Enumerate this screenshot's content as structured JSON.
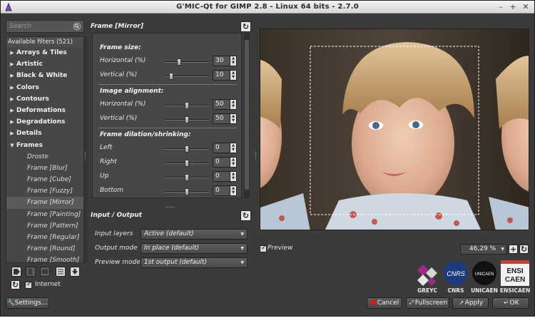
{
  "window": {
    "title": "G'MIC-Qt for GIMP 2.8 - Linux 64 bits - 2.7.0"
  },
  "search": {
    "placeholder": "Search"
  },
  "filters": {
    "header": "Available filters (521)",
    "items": [
      {
        "label": "Arrays & Tiles",
        "kind": "cat",
        "arrow": "▶"
      },
      {
        "label": "Artistic",
        "kind": "cat",
        "arrow": "▶"
      },
      {
        "label": "Black & White",
        "kind": "cat",
        "arrow": "▶"
      },
      {
        "label": "Colors",
        "kind": "cat",
        "arrow": "▶"
      },
      {
        "label": "Contours",
        "kind": "cat",
        "arrow": "▶"
      },
      {
        "label": "Deformations",
        "kind": "cat",
        "arrow": "▶"
      },
      {
        "label": "Degradations",
        "kind": "cat",
        "arrow": "▶"
      },
      {
        "label": "Details",
        "kind": "cat",
        "arrow": "▶"
      },
      {
        "label": "Frames",
        "kind": "cat",
        "arrow": "▼"
      },
      {
        "label": "Droste",
        "kind": "sub"
      },
      {
        "label": "Frame [Blur]",
        "kind": "sub"
      },
      {
        "label": "Frame [Cube]",
        "kind": "sub"
      },
      {
        "label": "Frame [Fuzzy]",
        "kind": "sub"
      },
      {
        "label": "Frame [Mirror]",
        "kind": "sub",
        "selected": true
      },
      {
        "label": "Frame [Painting]",
        "kind": "sub"
      },
      {
        "label": "Frame [Pattern]",
        "kind": "sub"
      },
      {
        "label": "Frame [Regular]",
        "kind": "sub"
      },
      {
        "label": "Frame [Round]",
        "kind": "sub"
      },
      {
        "label": "Frame [Smooth]",
        "kind": "sub"
      }
    ]
  },
  "internet": {
    "label": "Internet",
    "checked": true
  },
  "settings_button": "Settings...",
  "filter_panel": {
    "title": "Frame [Mirror]",
    "groups": {
      "size": "Frame size:",
      "align": "Image alignment:",
      "dilation": "Frame dilation/shrinking:"
    },
    "params": {
      "size_h": {
        "label": "Horizontal (%)",
        "value": "30",
        "level": 0.3
      },
      "size_v": {
        "label": "Vertical (%)",
        "value": "10",
        "level": 0.1
      },
      "align_h": {
        "label": "Horizontal (%)",
        "value": "50",
        "level": 0.5
      },
      "align_v": {
        "label": "Vertical (%)",
        "value": "50",
        "level": 0.5
      },
      "left": {
        "label": "Left",
        "value": "0",
        "level": 0.5
      },
      "right": {
        "label": "Right",
        "value": "0",
        "level": 0.5
      },
      "up": {
        "label": "Up",
        "value": "0",
        "level": 0.5
      },
      "bottom": {
        "label": "Bottom",
        "value": "0",
        "level": 0.5
      }
    }
  },
  "io": {
    "title": "Input / Output",
    "input_layers": {
      "label": "Input layers",
      "value": "Active (default)"
    },
    "output_mode": {
      "label": "Output mode",
      "value": "In place (default)"
    },
    "preview_mode": {
      "label": "Preview mode",
      "value": "1st output (default)"
    }
  },
  "preview": {
    "label": "Preview",
    "checked": true,
    "zoom": "46,29 %"
  },
  "logos": [
    "GREYC",
    "CNRS",
    "UNICAEN",
    "ENSICAEN"
  ],
  "logo_text": {
    "cnrs": "CNRS",
    "unicaen": "UNICAEN",
    "ensi": "ENSI",
    "caen": "CAEN"
  },
  "buttons": {
    "cancel": "Cancel",
    "fullscreen": "Fullscreen",
    "apply": "Apply",
    "ok": "OK"
  },
  "colors": {
    "accent": "#d01c1c",
    "panel": "#3b3b3b",
    "list": "#474747"
  }
}
